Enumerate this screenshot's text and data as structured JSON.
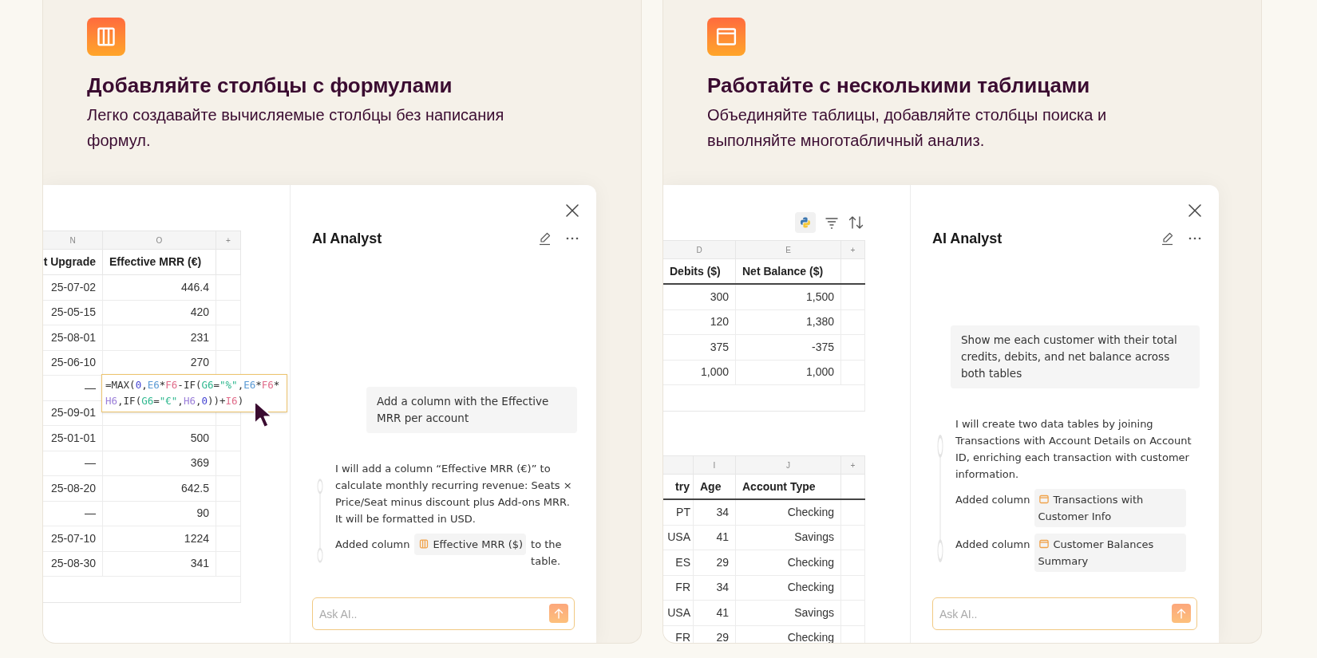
{
  "cards": [
    {
      "kind": "columns",
      "title": "Добавляйте столбцы с формулами",
      "subtitle": "Легко создавайте вычисляемые столбцы без написания формул.",
      "tables": [
        {
          "emphasized_header": false,
          "columns": [
            {
              "letter": "N",
              "name": "t Upgrade"
            },
            {
              "letter": "O",
              "name": "Effective MRR (€)"
            },
            {
              "letter": "+"
            }
          ],
          "rows": [
            [
              "25-07-02",
              "446.4"
            ],
            [
              "25-05-15",
              "420"
            ],
            [
              "25-08-01",
              "231"
            ],
            [
              "25-06-10",
              "270"
            ],
            [
              "—",
              null
            ],
            [
              "25-09-01",
              null
            ],
            [
              "25-01-01",
              "500"
            ],
            [
              "—",
              "369"
            ],
            [
              "25-08-20",
              "642.5"
            ],
            [
              "—",
              "90"
            ],
            [
              "25-07-10",
              "1224"
            ],
            [
              "25-08-30",
              "341"
            ]
          ]
        }
      ],
      "formula_tooltip": {
        "tokens": [
          {
            "text": "=MAX("
          },
          {
            "text": "0",
            "color": "#3f3fd1"
          },
          {
            "text": ","
          },
          {
            "text": "E6",
            "color": "#5b9bd5"
          },
          {
            "text": "*"
          },
          {
            "text": "F6",
            "color": "#e06c8a"
          },
          {
            "text": "-IF("
          },
          {
            "text": "G6",
            "color": "#2fb88f"
          },
          {
            "text": "="
          },
          {
            "text": "\"%\"",
            "color": "#2fb88f"
          },
          {
            "text": ","
          },
          {
            "text": "E6",
            "color": "#5b9bd5"
          },
          {
            "text": "*"
          },
          {
            "text": "F6",
            "color": "#e06c8a"
          },
          {
            "text": "*"
          },
          {
            "text": "H6",
            "color": "#9b7fd9"
          },
          {
            "text": ",IF("
          },
          {
            "text": "G6",
            "color": "#2fb88f"
          },
          {
            "text": "="
          },
          {
            "text": "\"€\"",
            "color": "#2fb88f"
          },
          {
            "text": ","
          },
          {
            "text": "H6",
            "color": "#9b7fd9"
          },
          {
            "text": ","
          },
          {
            "text": "0",
            "color": "#3f3fd1"
          },
          {
            "text": "))+"
          },
          {
            "text": "I6",
            "color": "#e06c8a"
          },
          {
            "text": ")"
          }
        ]
      },
      "chat": {
        "title": "AI Analyst",
        "user_message": "Add a column with the Effective MRR per account",
        "reply": "I will add a column “Effective MRR (€)” to calculate monthly recurring revenue: Seats × Price/Seat minus discount plus Add-ons MRR. It will be formatted in USD.",
        "actions": [
          {
            "prefix": "Added column",
            "chip": "Effective MRR ($)",
            "suffix": "to the table."
          }
        ],
        "input": {
          "placeholder": "Ask AI.."
        }
      }
    },
    {
      "kind": "tables",
      "title": "Работайте с несколькими таблицами",
      "subtitle": "Объединяйте таблицы, добавляйте столбцы поиска и выполняйте многотабличный анализ.",
      "toolbar": true,
      "tables": [
        {
          "emphasized_header": true,
          "columns": [
            {
              "letter": "D",
              "name": "Debits ($)"
            },
            {
              "letter": "E",
              "name": "Net Balance ($)"
            },
            {
              "letter": "+"
            }
          ],
          "rows": [
            [
              "300",
              "1,500"
            ],
            [
              "120",
              "1,380"
            ],
            [
              "375",
              "-375"
            ],
            [
              "1,000",
              "1,000"
            ]
          ]
        },
        {
          "emphasized_header": true,
          "columns": [
            {
              "name": "try"
            },
            {
              "letter": "I",
              "name": "Age"
            },
            {
              "letter": "J",
              "name": "Account Type"
            },
            {
              "letter": "+"
            }
          ],
          "rows": [
            [
              "PT",
              "34",
              "Checking"
            ],
            [
              "USA",
              "41",
              "Savings"
            ],
            [
              "ES",
              "29",
              "Checking"
            ],
            [
              "FR",
              "34",
              "Checking"
            ],
            [
              "USA",
              "41",
              "Savings"
            ],
            [
              "FR",
              "29",
              "Checking"
            ]
          ]
        }
      ],
      "chat": {
        "title": "AI Analyst",
        "user_message": "Show me each customer with their total credits, debits, and net balance across both tables",
        "reply": "I will create two data tables by joining Transactions with Account Details on Account ID, enriching each transaction with customer information.",
        "actions": [
          {
            "prefix": "Added column",
            "chip": "Transactions with Customer Info"
          },
          {
            "prefix": "Added column",
            "chip": "Customer Balances Summary"
          }
        ],
        "input": {
          "placeholder": "Ask AI.."
        }
      }
    }
  ]
}
